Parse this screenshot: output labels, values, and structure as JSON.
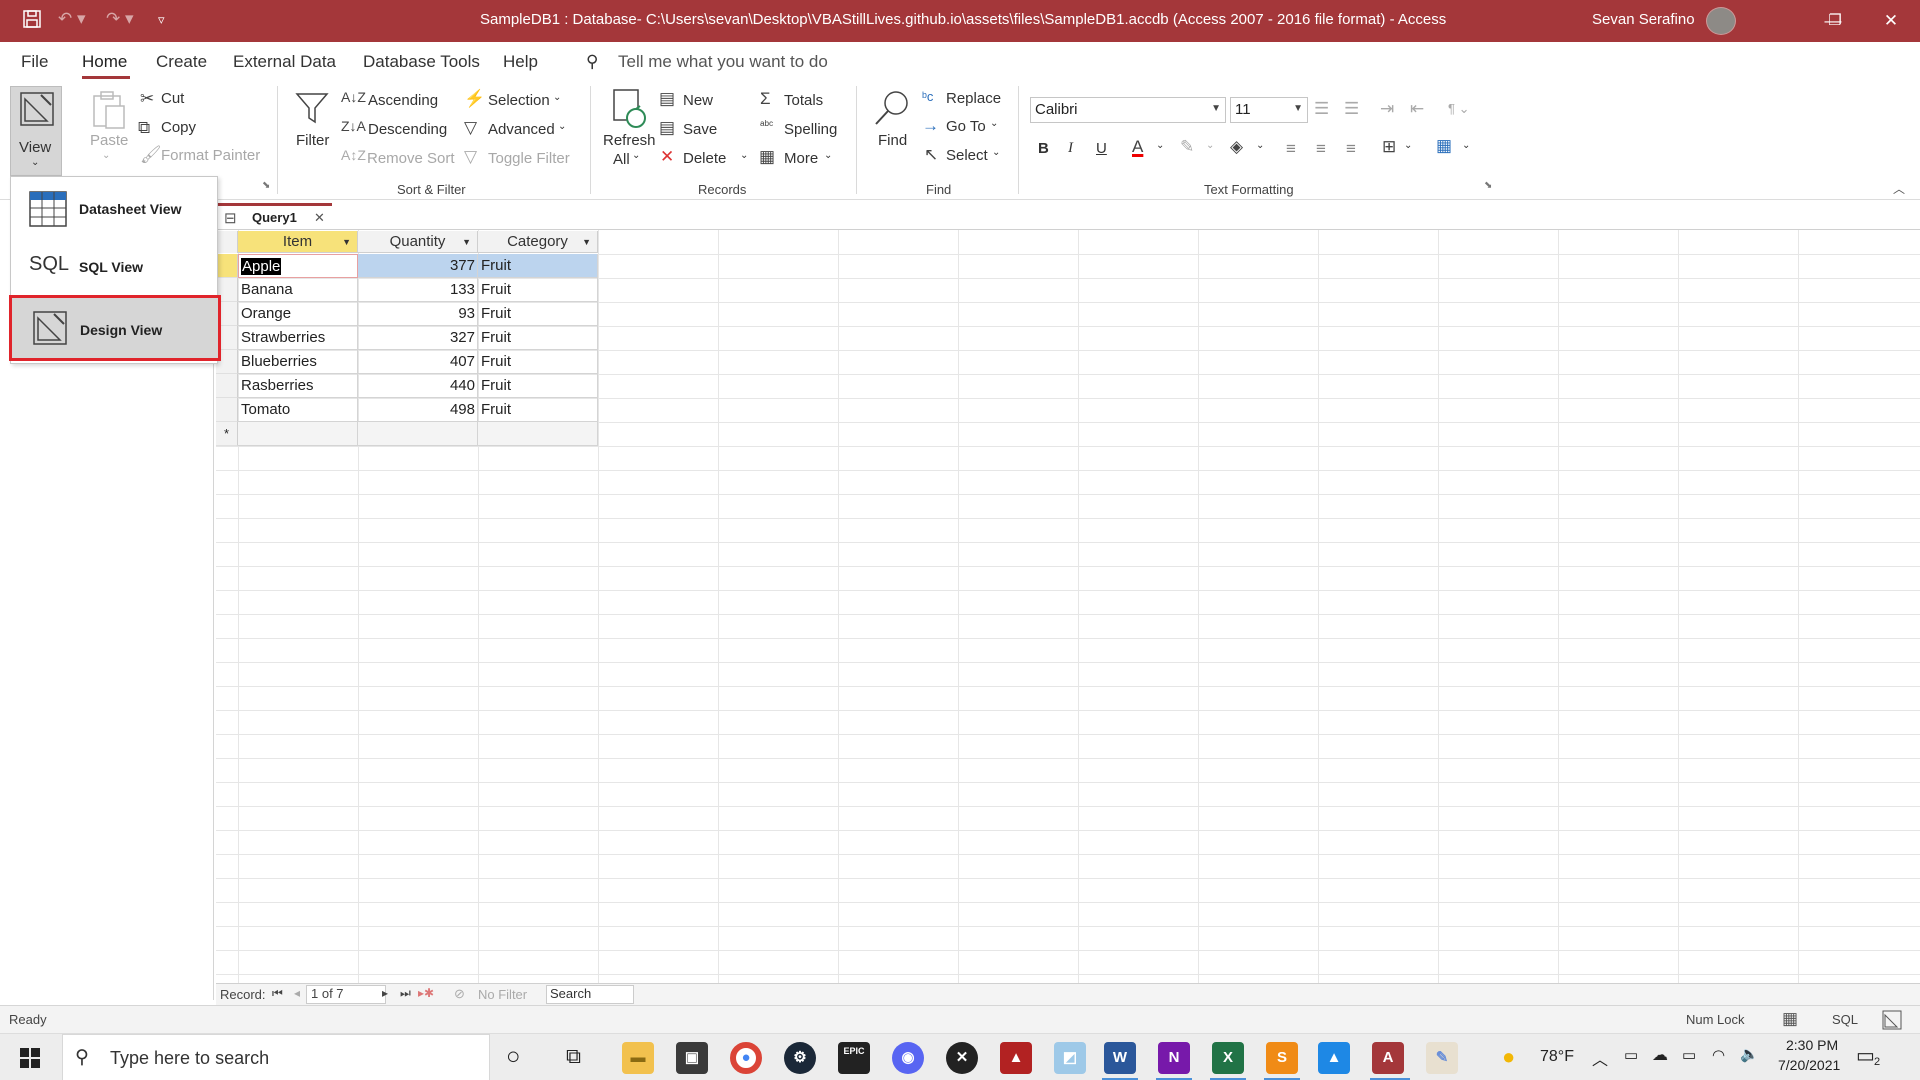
{
  "window": {
    "title": "SampleDB1 : Database- C:\\Users\\sevan\\Desktop\\VBAStillLives.github.io\\assets\\files\\SampleDB1.accdb (Access 2007 - 2016 file format)  -  Access",
    "user_name": "Sevan Serafino",
    "accent_color": "#a4373a"
  },
  "menu": {
    "items": [
      "File",
      "Home",
      "Create",
      "External Data",
      "Database Tools",
      "Help"
    ],
    "active": "Home",
    "tell_me_placeholder": "Tell me what you want to do"
  },
  "ribbon": {
    "views": {
      "view_label": "View"
    },
    "clipboard": {
      "paste": "Paste",
      "cut": "Cut",
      "copy": "Copy",
      "format_painter": "Format Painter"
    },
    "sort_filter": {
      "group": "Sort & Filter",
      "filter": "Filter",
      "ascending": "Ascending",
      "descending": "Descending",
      "remove_sort": "Remove Sort",
      "selection": "Selection",
      "advanced": "Advanced",
      "toggle_filter": "Toggle Filter"
    },
    "records": {
      "group": "Records",
      "refresh": "Refresh",
      "refresh_all": "All",
      "new": "New",
      "save": "Save",
      "delete": "Delete",
      "totals": "Totals",
      "spelling": "Spelling",
      "more": "More"
    },
    "find": {
      "group": "Find",
      "find": "Find",
      "replace": "Replace",
      "goto": "Go To",
      "select": "Select"
    },
    "text_formatting": {
      "group": "Text Formatting",
      "font": "Calibri",
      "size": "11",
      "bold": "B",
      "italic": "I",
      "underline": "U"
    }
  },
  "view_dropdown": {
    "items": [
      {
        "label": "Datasheet View",
        "icon": "datasheet-icon"
      },
      {
        "label": "SQL View",
        "icon": "sql-icon",
        "icon_text": "SQL"
      },
      {
        "label": "Design View",
        "icon": "design-view-icon",
        "highlighted": true
      }
    ]
  },
  "document_tab": {
    "label": "Query1"
  },
  "datasheet": {
    "columns": [
      "Item",
      "Quantity",
      "Category"
    ],
    "rows": [
      {
        "item": "Apple",
        "quantity": "377",
        "category": "Fruit"
      },
      {
        "item": "Banana",
        "quantity": "133",
        "category": "Fruit"
      },
      {
        "item": "Orange",
        "quantity": "93",
        "category": "Fruit"
      },
      {
        "item": "Strawberries",
        "quantity": "327",
        "category": "Fruit"
      },
      {
        "item": "Blueberries",
        "quantity": "407",
        "category": "Fruit"
      },
      {
        "item": "Rasberries",
        "quantity": "440",
        "category": "Fruit"
      },
      {
        "item": "Tomato",
        "quantity": "498",
        "category": "Fruit"
      }
    ],
    "new_row_marker": "*"
  },
  "record_nav": {
    "label": "Record:",
    "position": "1 of 7",
    "filter": "No Filter",
    "search": "Search"
  },
  "status": {
    "ready": "Ready",
    "num_lock": "Num Lock",
    "sql": "SQL"
  },
  "taskbar": {
    "search_placeholder": "Type here to search",
    "weather": "78°F",
    "time": "2:30 PM",
    "date": "7/20/2021",
    "notifications": "2"
  }
}
